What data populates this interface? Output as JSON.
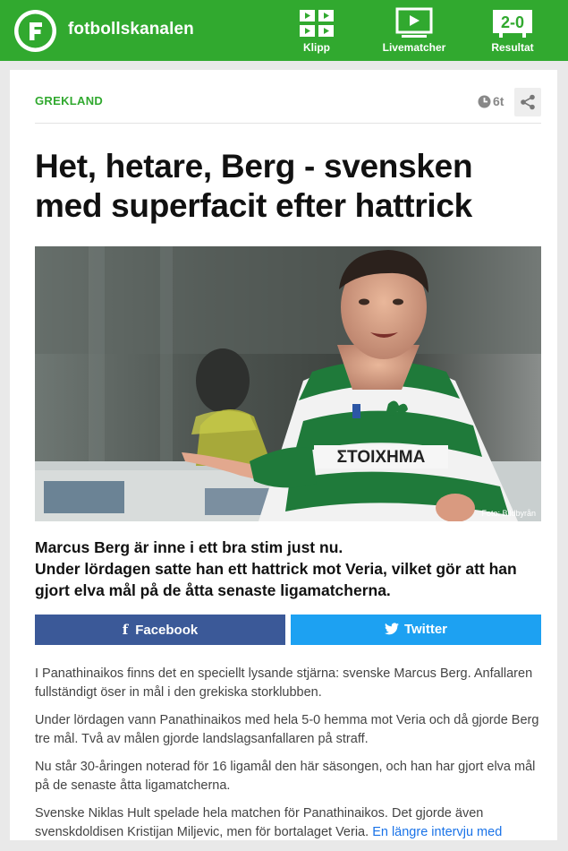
{
  "header": {
    "brand": "fotbollskanalen",
    "logo_letter": "F",
    "nav": [
      {
        "label": "Klipp",
        "icon": "grid-icon"
      },
      {
        "label": "Livematcher",
        "icon": "tv-icon"
      },
      {
        "label": "Resultat",
        "icon": "scoreboard-icon"
      }
    ],
    "scoreboard_text": "2-0",
    "accent_color": "#31a92f"
  },
  "article": {
    "category": "GREKLAND",
    "time_ago": "6t",
    "headline": "Het, hetare, Berg - svensken med superfacit efter hattrick",
    "jersey_text": "ΣΤΟΙΧΗΜΑ",
    "photo_credit": "Foto: Bildbyrån",
    "lead": [
      "Marcus Berg är inne i ett bra stim just nu.",
      "Under lördagen satte han ett hattrick mot Veria, vilket gör att han gjort elva mål på de åtta senaste ligamatcherna."
    ],
    "share": {
      "facebook_label": "Facebook",
      "twitter_label": "Twitter",
      "facebook_color": "#3b5998",
      "twitter_color": "#1da1f2"
    },
    "paragraphs": [
      "I Panathinaikos finns det en speciellt lysande stjärna: svenske Marcus Berg. Anfallaren fullständigt öser in mål i den grekiska storklubben.",
      "Under lördagen vann Panathinaikos med hela 5-0 hemma mot Veria och då gjorde Berg tre mål. Två av målen gjorde landslagsanfallaren på straff.",
      "Nu står 30-åringen noterad för 16 ligamål den här säsongen, och han har gjort elva mål på de senaste åtta ligamatcherna."
    ],
    "last_paragraph": "Svenske Niklas Hult spelade hela matchen för Panathinaikos. Det gjorde även svenskdoldisen Kristijan Miljevic, men för bortalaget Veria.",
    "last_link": "En längre intervju med"
  }
}
